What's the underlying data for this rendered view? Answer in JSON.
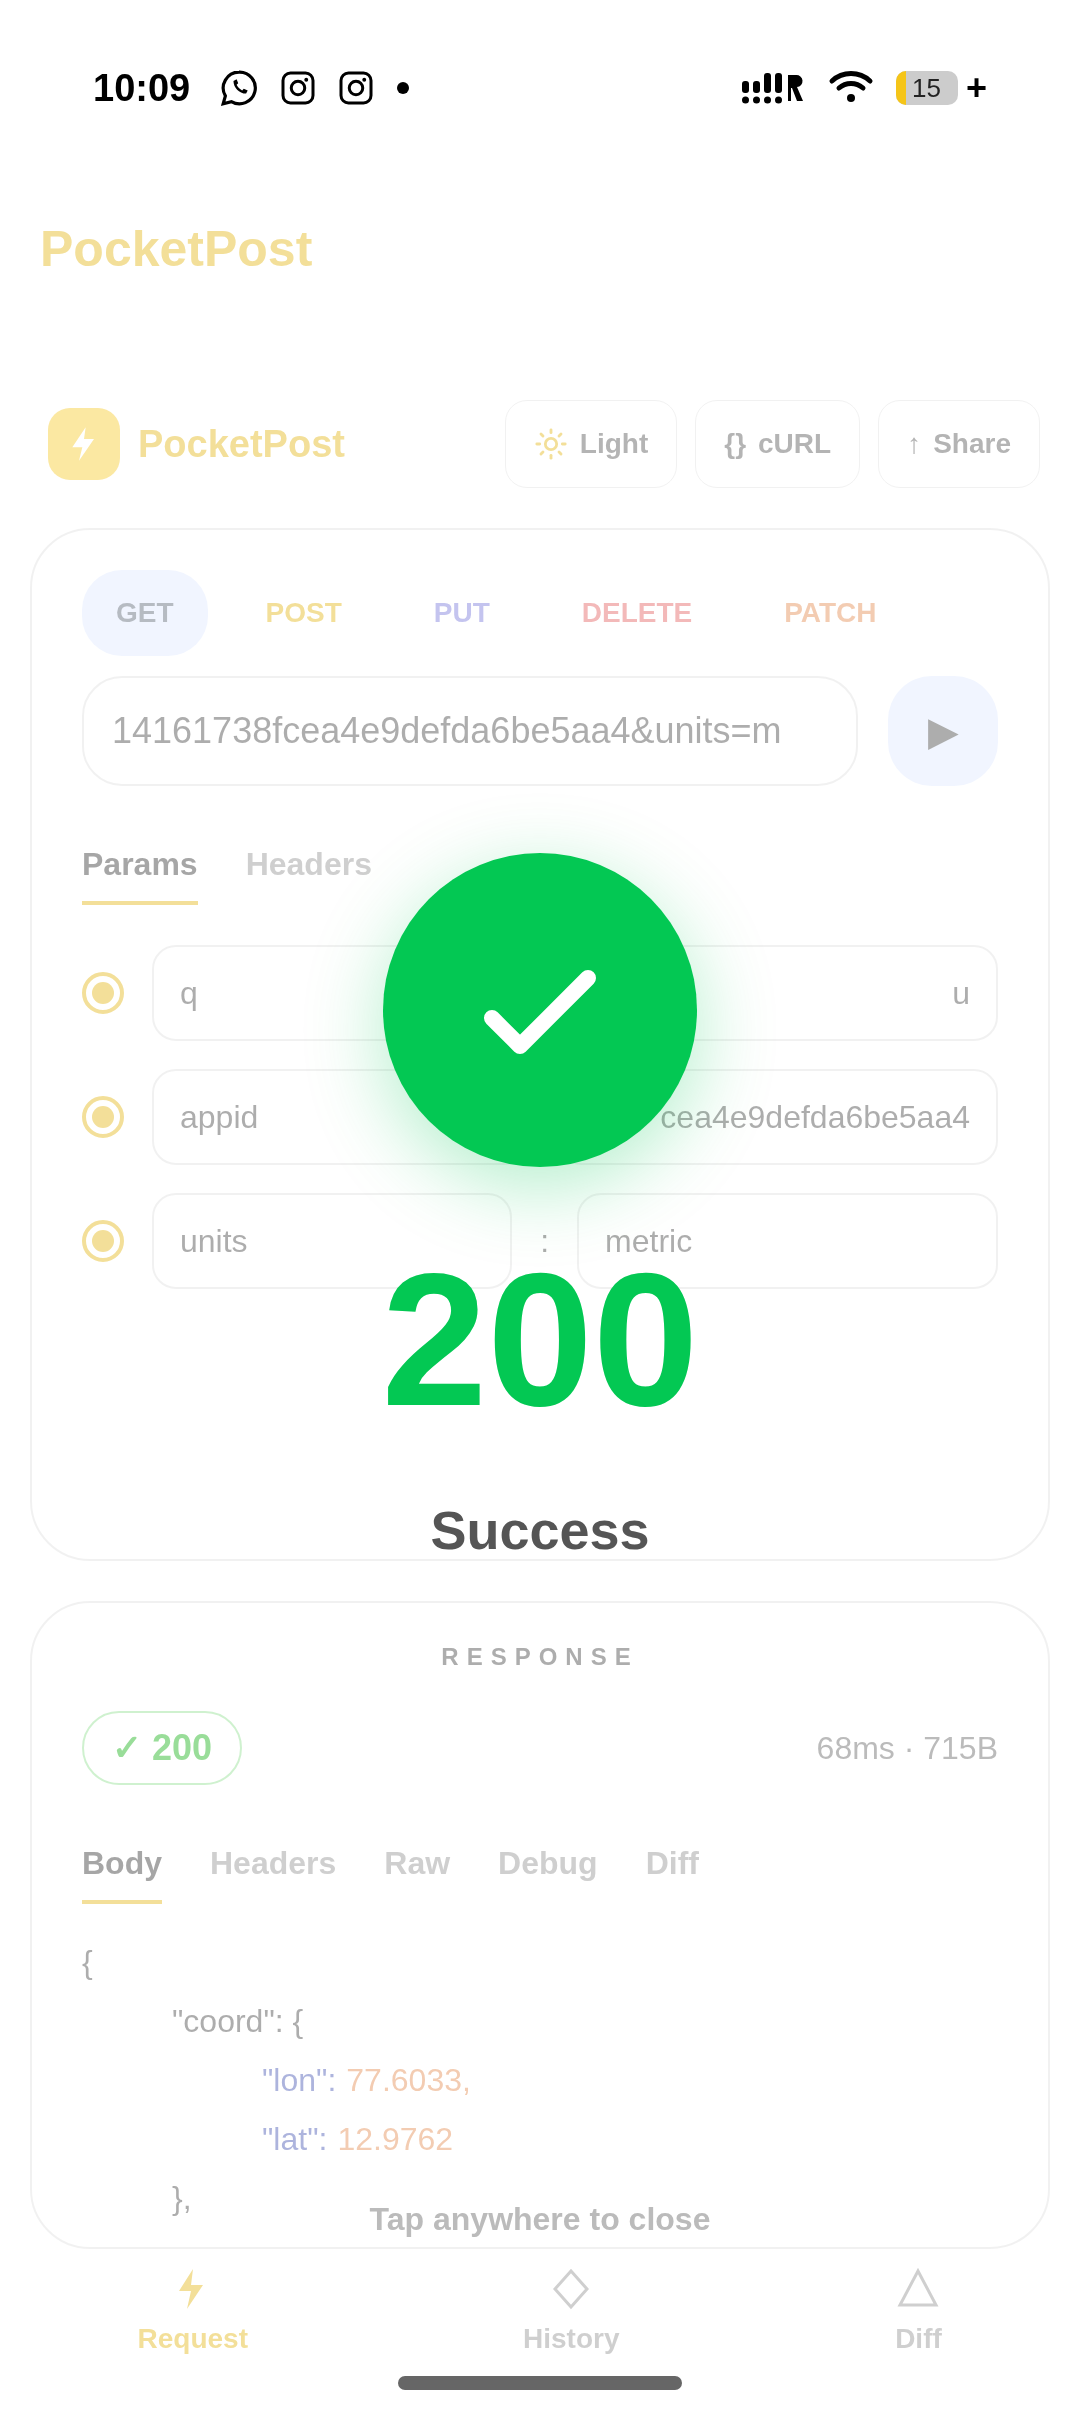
{
  "status_bar": {
    "time": "10:09",
    "battery": "15",
    "charging": "+"
  },
  "app_title": "PocketPost",
  "header": {
    "logo_text": "PocketPost",
    "buttons": [
      {
        "kind": "sun",
        "label": "Light"
      },
      {
        "kind": "glyph",
        "glyph": "{}",
        "label": "cURL"
      },
      {
        "kind": "glyph",
        "glyph": "↑",
        "label": "Share"
      }
    ]
  },
  "request": {
    "methods": [
      {
        "label": "GET",
        "selected": true
      },
      {
        "label": "POST",
        "selected": false
      },
      {
        "label": "PUT",
        "selected": false
      },
      {
        "label": "DELETE",
        "selected": false
      },
      {
        "label": "PATCH",
        "selected": false
      }
    ],
    "url": "14161738fcea4e9defda6be5aa4&units=m",
    "send_glyph": "▶",
    "tabs": [
      {
        "label": "Params",
        "selected": true
      },
      {
        "label": "Headers",
        "selected": false
      }
    ],
    "params": [
      {
        "key": "q",
        "value": "u",
        "checked": true
      },
      {
        "key": "appid",
        "value": "cea4e9defda6be5aa4",
        "checked": true
      },
      {
        "key": "units",
        "separator": ":",
        "value": "metric",
        "checked": true
      }
    ]
  },
  "response": {
    "title": "RESPONSE",
    "status_glyph": "✓",
    "status_code": "200",
    "timing": "68ms · 715B",
    "tabs": [
      {
        "label": "Body",
        "selected": true
      },
      {
        "label": "Headers",
        "selected": false
      },
      {
        "label": "Raw",
        "selected": false
      },
      {
        "label": "Debug",
        "selected": false
      },
      {
        "label": "Diff",
        "selected": false
      }
    ],
    "body": [
      {
        "text": "{",
        "children": [
          {
            "text": "\"coord\": {",
            "children": [
              {
                "key": "\"lon\":",
                "value": "77.6033,"
              },
              {
                "key": "\"lat\":",
                "value": "12.9762"
              }
            ]
          },
          {
            "text": "},"
          }
        ]
      }
    ]
  },
  "bottom_nav": [
    {
      "kind": "bolt",
      "label": "Request",
      "selected": true
    },
    {
      "kind": "diamond",
      "label": "History",
      "selected": false
    },
    {
      "kind": "triangle",
      "label": "Diff",
      "selected": false
    }
  ],
  "dialog": {
    "code": "200",
    "message": "Success",
    "hint": "Tap anywhere to close"
  }
}
